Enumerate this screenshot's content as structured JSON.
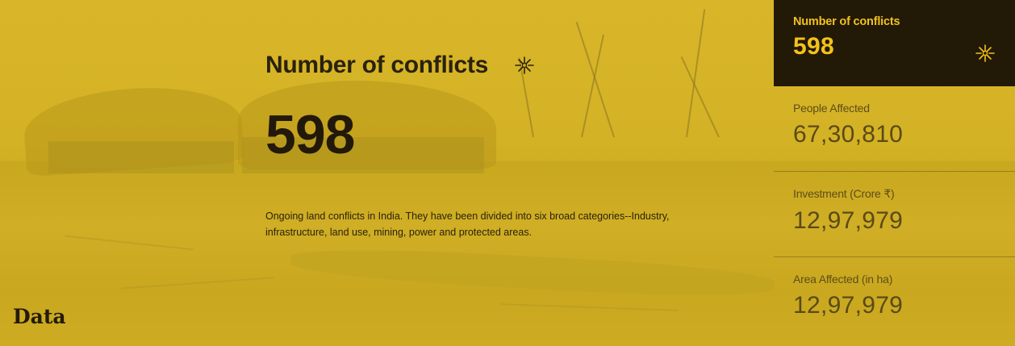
{
  "main": {
    "title": "Number of conflicts",
    "icon": "burst-icon",
    "value": "598",
    "description": "Ongoing land conflicts in India. They have been divided into six broad categories--Industry, infrastructure, land use, mining, power and protected areas."
  },
  "section_label": "Data",
  "sidebar": {
    "items": [
      {
        "label": "Number of conflicts",
        "value": "598",
        "active": true,
        "icon": "burst-icon"
      },
      {
        "label": "People Affected",
        "value": "67,30,810",
        "active": false
      },
      {
        "label": "Investment (Crore ₹)",
        "value": "12,97,979",
        "active": false
      },
      {
        "label": "Area Affected (in ha)",
        "value": "12,97,979",
        "active": false
      }
    ]
  },
  "colors": {
    "background": "#d2b11f",
    "sidebar_active_bg": "#231907",
    "accent": "#f3c21b",
    "text_dark": "#22190a"
  }
}
